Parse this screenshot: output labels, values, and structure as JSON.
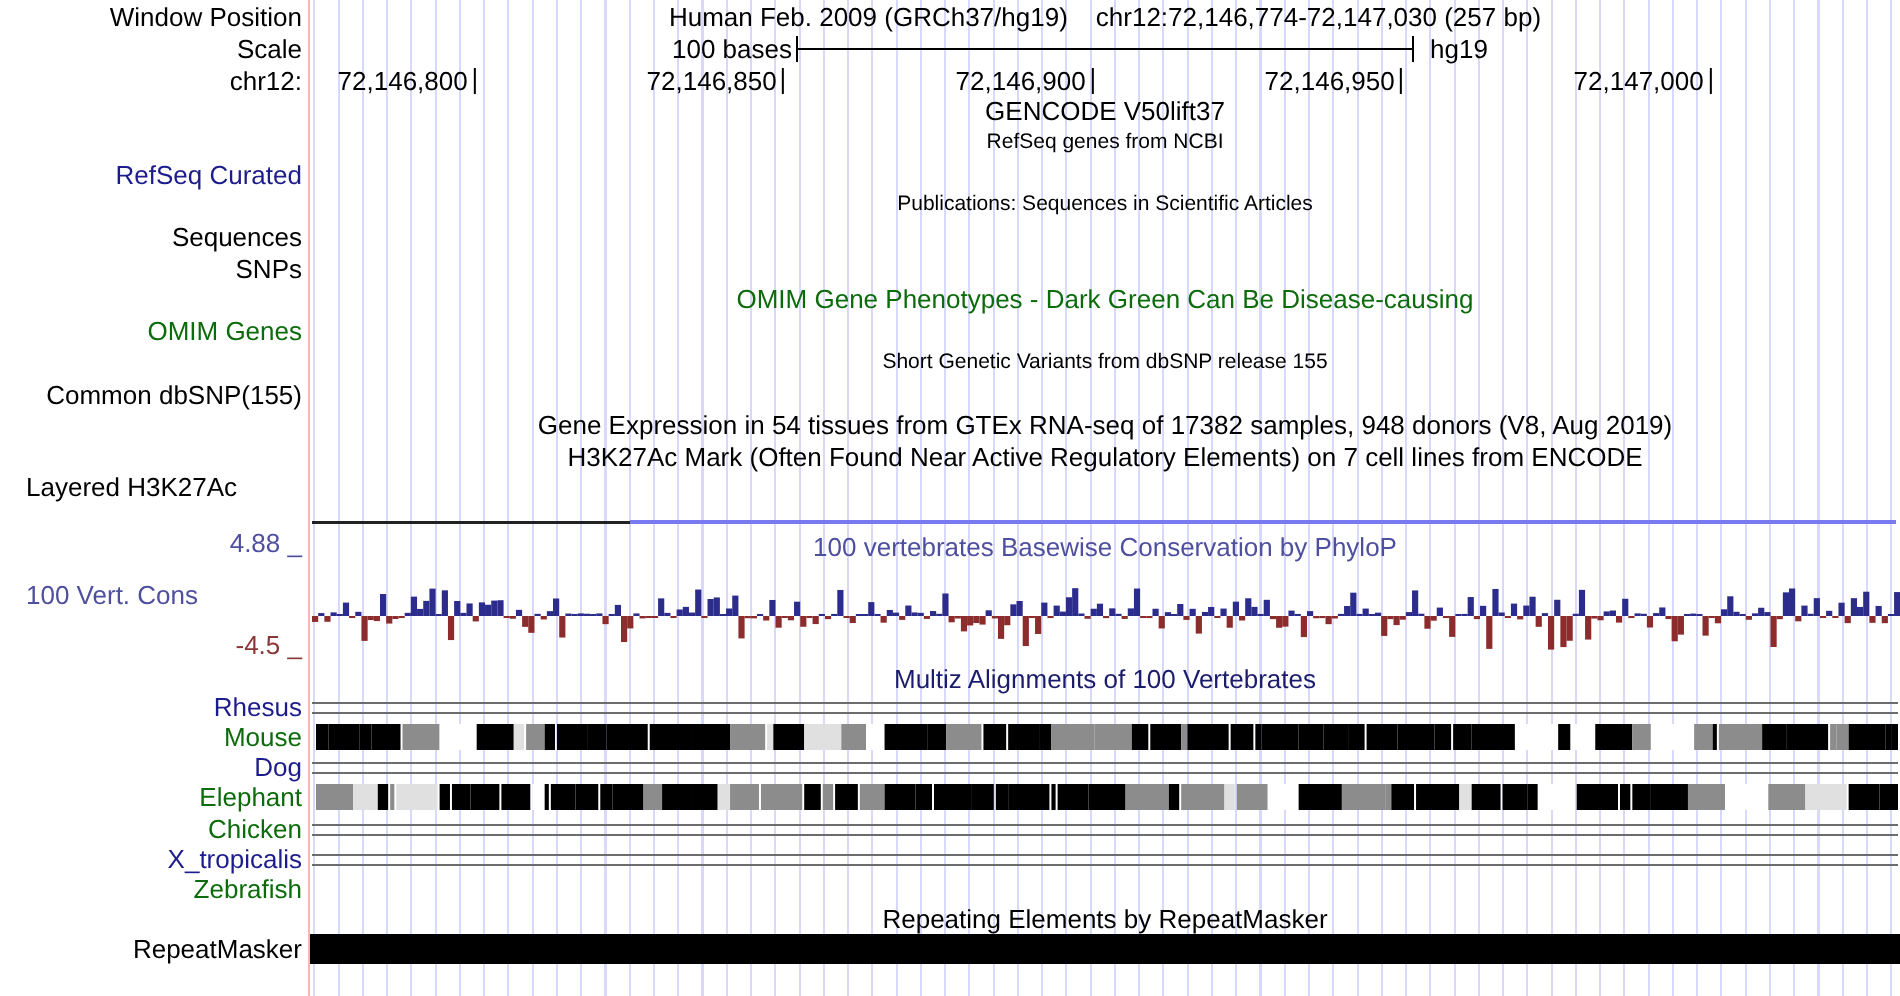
{
  "header": {
    "position_label": "Window Position",
    "assembly": "Human Feb. 2009 (GRCh37/hg19)",
    "position": "chr12:72,146,774-72,147,030 (257 bp)",
    "scale_label": "Scale",
    "scale_length": "100 bases",
    "scale_db": "hg19",
    "chrom_label": "chr12:",
    "ticks": [
      "72,146,800",
      "72,146,850",
      "72,146,900",
      "72,146,950",
      "72,147,000"
    ]
  },
  "tracks": [
    {
      "kind": "title",
      "text": "GENCODE V50lift37",
      "color": "#000000"
    },
    {
      "kind": "caption",
      "text": "RefSeq genes from NCBI",
      "color": "#000000"
    },
    {
      "kind": "label",
      "text": "RefSeq Curated",
      "color": "#1c1c8c"
    },
    {
      "kind": "caption",
      "text": "Publications: Sequences in Scientific Articles",
      "color": "#000000"
    },
    {
      "kind": "label",
      "text": "Sequences",
      "color": "#000000"
    },
    {
      "kind": "label",
      "text": "SNPs",
      "color": "#000000"
    },
    {
      "kind": "title",
      "text": "OMIM Gene Phenotypes - Dark Green Can Be Disease-causing",
      "color": "#0c6c0c"
    },
    {
      "kind": "label",
      "text": "OMIM Genes",
      "color": "#0c6c0c"
    },
    {
      "kind": "caption",
      "text": "Short Genetic Variants from dbSNP release 155",
      "color": "#000000"
    },
    {
      "kind": "label",
      "text": "Common dbSNP(155)",
      "color": "#000000"
    },
    {
      "kind": "title",
      "text": "Gene Expression in 54 tissues from GTEx RNA-seq of 17382 samples, 948 donors (V8, Aug 2019)",
      "color": "#000000"
    },
    {
      "kind": "title",
      "text": "H3K27Ac Mark (Often Found Near Active Regulatory Elements) on 7 cell lines from ENCODE",
      "color": "#000000"
    }
  ],
  "signal": {
    "label": "Layered H3K27Ac"
  },
  "conservation": {
    "max": "4.88 _",
    "label": "100 Vert. Cons",
    "min": "-4.5 _",
    "title": "100 vertebrates Basewise Conservation by PhyloP"
  },
  "alignments": {
    "title": "Multiz Alignments of 100 Vertebrates",
    "species": [
      {
        "name": "Rhesus",
        "color": "#1c1c8c",
        "kind": "lines"
      },
      {
        "name": "Mouse",
        "color": "#0c6c0c",
        "kind": "blocks"
      },
      {
        "name": "Dog",
        "color": "#1c1c8c",
        "kind": "lines"
      },
      {
        "name": "Elephant",
        "color": "#0c6c0c",
        "kind": "blocks"
      },
      {
        "name": "Chicken",
        "color": "#0c6c0c",
        "kind": "lines"
      },
      {
        "name": "X_tropicalis",
        "color": "#1c1c8c",
        "kind": "lines"
      },
      {
        "name": "Zebrafish",
        "color": "#0c6c0c",
        "kind": "empty"
      }
    ]
  },
  "repeats": {
    "title": "Repeating Elements by RepeatMasker",
    "label": "RepeatMasker"
  }
}
